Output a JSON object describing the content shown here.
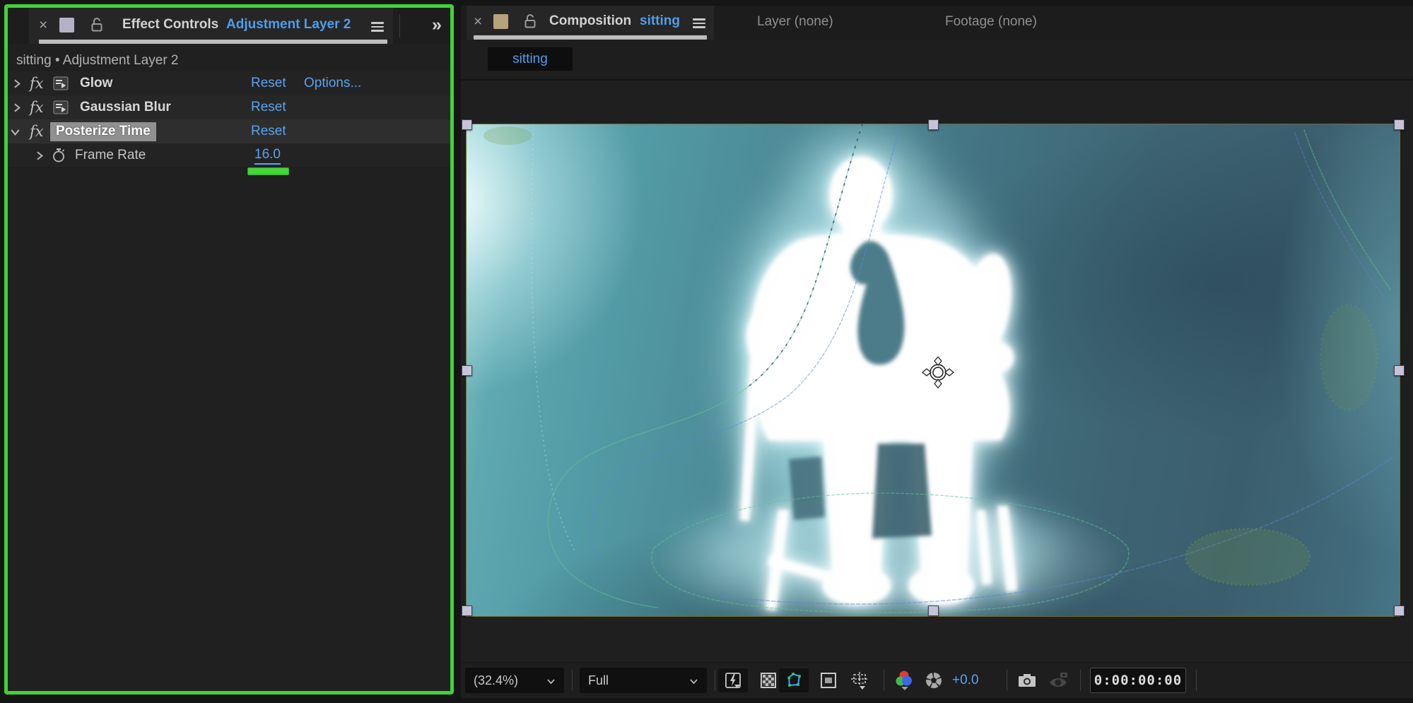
{
  "colors": {
    "accent_blue": "#4f9dea",
    "link_blue": "#5aa2ee",
    "annotation_green": "#3fd33a",
    "handle_fill": "#c6c3d9",
    "selection_outline_yellow": "#d7ca55",
    "ec_chip": "#b4b1c7",
    "comp_chip": "#b5a37c"
  },
  "icons": {
    "close": "×",
    "menu": "≡",
    "collapse": "»",
    "fx": "fx",
    "lock": "padlock-open",
    "stopwatch": "stopwatch",
    "expander_collapsed": "chevron-right",
    "expander_expanded": "chevron-down",
    "fast_previews": "lightning-square",
    "transparency_grid": "checkerboard",
    "mask_visibility": "blue-trapezoid",
    "region_of_interest": "square-inset",
    "grid_guides": "crosshair-square",
    "channels": "rgb-circles",
    "reset_exposure": "aperture",
    "snapshot": "camera",
    "show_snapshot": "camera-eye",
    "anchor": "crosshair"
  },
  "effect_controls": {
    "panel_title": "Effect Controls",
    "panel_layer": "Adjustment Layer 2",
    "header": "sitting • Adjustment Layer 2",
    "effects": [
      {
        "name": "Glow",
        "reset": "Reset",
        "options": "Options..."
      },
      {
        "name": "Gaussian Blur",
        "reset": "Reset"
      },
      {
        "name": "Posterize Time",
        "reset": "Reset"
      }
    ],
    "frame_rate": {
      "label": "Frame Rate",
      "value": "16.0"
    }
  },
  "viewer": {
    "tab_composition": "Composition",
    "tab_composition_name": "sitting",
    "tab_layer": "Layer (none)",
    "tab_footage": "Footage (none)",
    "subtab": "sitting",
    "toolbar": {
      "zoom": "(32.4%)",
      "resolution": "Full",
      "exposure": "+0.0",
      "timecode": "0:00:00:00"
    }
  }
}
